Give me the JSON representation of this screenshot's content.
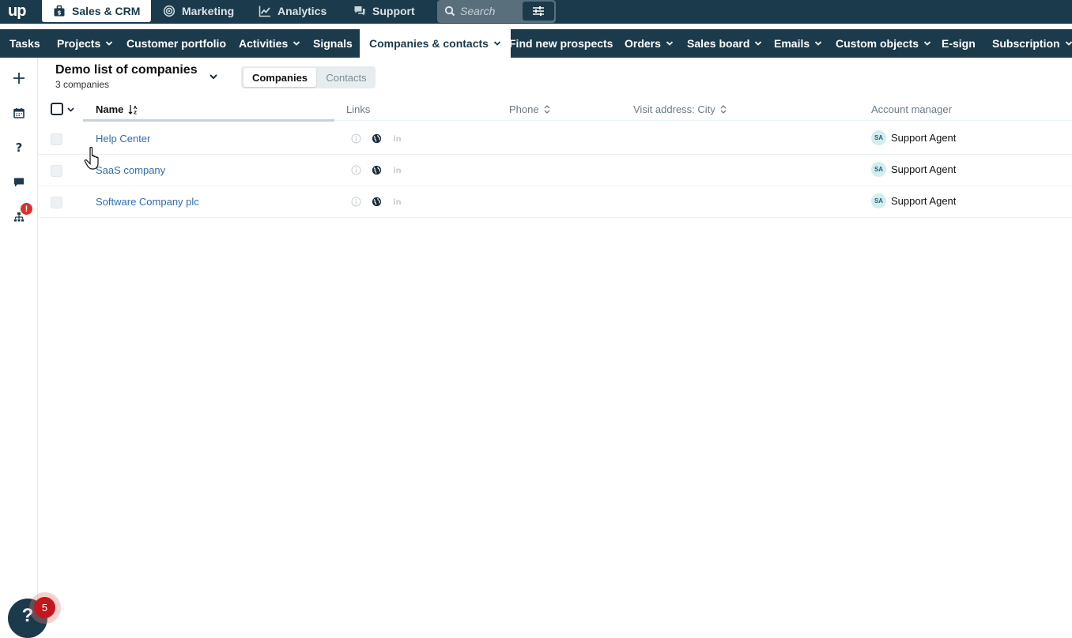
{
  "brand": {
    "logo_text": "up"
  },
  "app_tabs": [
    {
      "label": "Sales & CRM",
      "icon": "briefcase-icon",
      "active": true
    },
    {
      "label": "Marketing",
      "icon": "target-icon",
      "active": false
    },
    {
      "label": "Analytics",
      "icon": "chart-line-icon",
      "active": false
    },
    {
      "label": "Support",
      "icon": "chat-bubbles-icon",
      "active": false
    }
  ],
  "search": {
    "placeholder": "Search",
    "settings_icon": "sliders-icon"
  },
  "module_nav": [
    {
      "label": "Tasks",
      "dropdown": false
    },
    {
      "label": "Projects",
      "dropdown": true
    },
    {
      "label": "Customer portfolio",
      "dropdown": false
    },
    {
      "label": "Activities",
      "dropdown": true
    },
    {
      "label": "Signals",
      "dropdown": false
    },
    {
      "label": "Companies & contacts",
      "dropdown": true,
      "active": true
    },
    {
      "label": "Find new prospects",
      "dropdown": false
    },
    {
      "label": "Orders",
      "dropdown": true
    },
    {
      "label": "Sales board",
      "dropdown": true
    },
    {
      "label": "Emails",
      "dropdown": true
    },
    {
      "label": "Custom objects",
      "dropdown": true
    },
    {
      "label": "E-sign",
      "dropdown": false
    },
    {
      "label": "Subscription",
      "dropdown": true
    }
  ],
  "left_rail": {
    "items": [
      "plus-icon",
      "calendar-icon",
      "question-icon",
      "chat-icon",
      "sitemap-icon"
    ],
    "alert_badge": "!"
  },
  "list": {
    "title": "Demo list of companies",
    "count": "3 companies",
    "toggle": {
      "active": "Companies",
      "inactive": "Contacts"
    }
  },
  "table": {
    "columns": [
      "Name",
      "Links",
      "Phone",
      "Visit address: City",
      "Account manager"
    ],
    "rows": [
      {
        "name": "Help Center",
        "phone": "",
        "city": "",
        "manager_initials": "SA",
        "manager": "Support Agent"
      },
      {
        "name": "SaaS company",
        "phone": "",
        "city": "",
        "manager_initials": "SA",
        "manager": "Support Agent"
      },
      {
        "name": "Software Company plc",
        "phone": "",
        "city": "",
        "manager_initials": "SA",
        "manager": "Support Agent"
      }
    ]
  },
  "help": {
    "label": "?",
    "badge": "5"
  },
  "colors": {
    "nav_bg": "#1b3a4b",
    "link": "#2f6db0",
    "alert": "#d93030"
  }
}
